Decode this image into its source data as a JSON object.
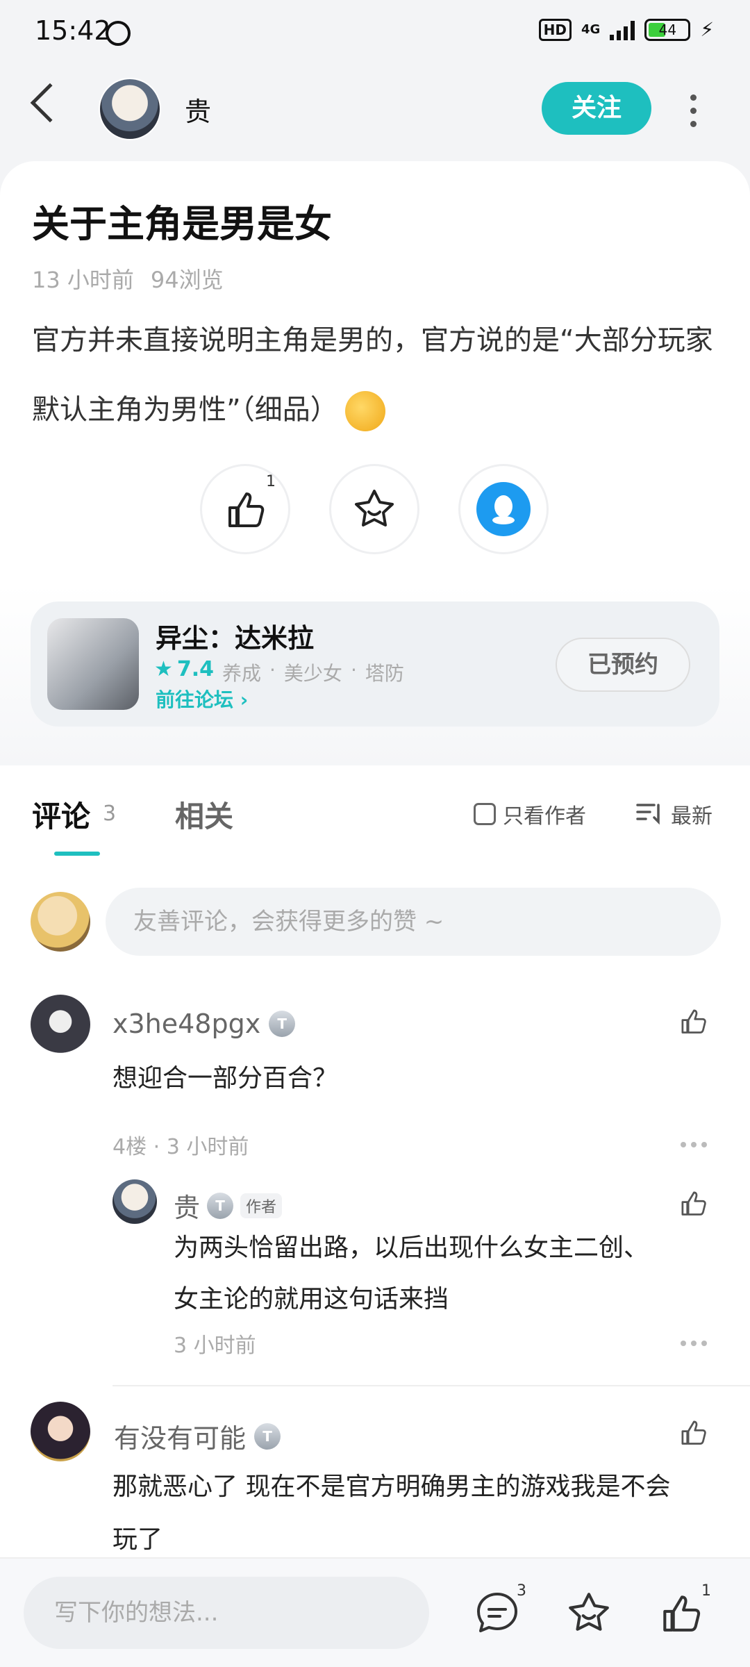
{
  "status_bar": {
    "time": "15:42",
    "network": "4G",
    "battery": "44"
  },
  "header": {
    "username": "贵",
    "follow_label": "关注"
  },
  "post": {
    "title": "关于主角是男是女",
    "time_ago": "13 小时前",
    "views": "94浏览",
    "body": "官方并未直接说明主角是男的，官方说的是“大部分玩家默认主角为男性”（细品）",
    "like_count": "1"
  },
  "game": {
    "name": "异尘：达米拉",
    "rating": "7.4",
    "tags": [
      "养成",
      "·",
      "美少女",
      "·",
      "塔防"
    ],
    "forum_link": "前往论坛",
    "reserved_label": "已预约"
  },
  "tabs": {
    "comments_label": "评论",
    "comments_count": "3",
    "related_label": "相关",
    "author_only_label": "只看作者",
    "sort_label": "最新"
  },
  "comment_input_placeholder": "友善评论，会获得更多的赞 ~",
  "comments": [
    {
      "name": "x3he48pgx",
      "text": "想迎合一部分百合？",
      "meta": "4楼 · 3 小时前",
      "reply": {
        "name": "贵",
        "author_tag": "作者",
        "text_line1": "为两头恰留出路，以后出现什么女主二创、",
        "text_line2": "女主论的就用这句话来挡",
        "meta": "3 小时前"
      }
    },
    {
      "name": "有没有可能",
      "text_line1": "那就恶心了 现在不是官方明确男主的游戏我是不会",
      "text_line2": "玩了"
    }
  ],
  "bottom_bar": {
    "placeholder": "写下你的想法...",
    "comment_count": "3",
    "like_count": "1"
  },
  "colors": {
    "accent": "#1ebfbf",
    "qq_blue": "#1d9bf0"
  }
}
